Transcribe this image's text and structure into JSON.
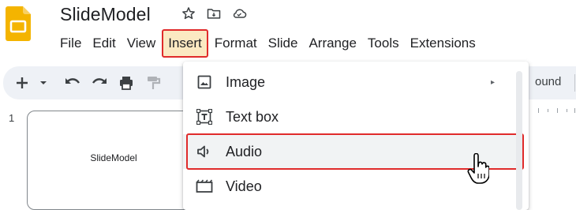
{
  "app": {
    "title": "SlideModel",
    "logo_icon": "google-slides-logo",
    "brand_color": "#f4b400",
    "title_icons": [
      "star-icon",
      "move-to-folder-icon",
      "cloud-status-icon"
    ]
  },
  "menubar": {
    "items": [
      "File",
      "Edit",
      "View",
      "Insert",
      "Format",
      "Slide",
      "Arrange",
      "Tools",
      "Extensions"
    ],
    "active": "Insert",
    "active_bg": "#fbe9c2",
    "highlight_color": "#e02b2b"
  },
  "toolbar": {
    "icons": [
      "new-slide-plus-icon",
      "new-slide-dropdown-icon",
      "undo-icon",
      "redo-icon",
      "print-icon",
      "paint-format-icon"
    ],
    "partial_label": "ound"
  },
  "filmstrip": {
    "slide_number": "1",
    "slide_text": "SlideModel"
  },
  "insert_menu": {
    "items": [
      {
        "label": "Image",
        "icon": "image-icon",
        "submenu": true
      },
      {
        "label": "Text box",
        "icon": "text-box-icon",
        "submenu": false
      },
      {
        "label": "Audio",
        "icon": "audio-icon",
        "submenu": false,
        "highlighted": true
      },
      {
        "label": "Video",
        "icon": "video-icon",
        "submenu": false
      }
    ],
    "submenu_arrow": "▸"
  },
  "cursor_icon": "hand-pointer-icon"
}
